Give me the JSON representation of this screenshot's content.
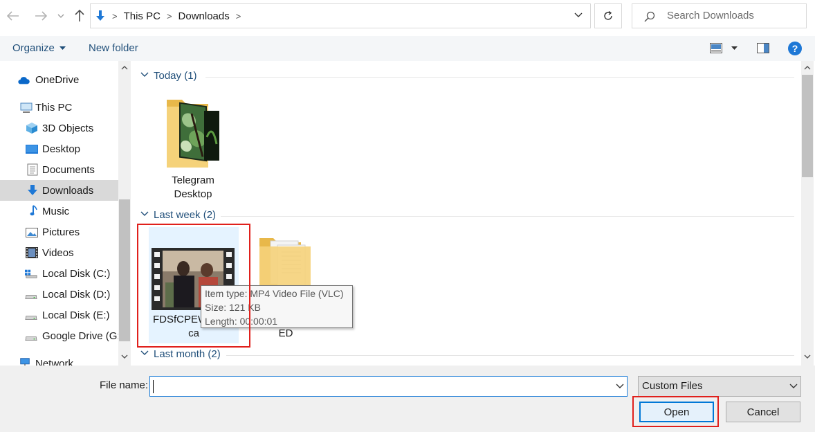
{
  "address_bar": {
    "crumbs": [
      "This PC",
      "Downloads"
    ],
    "search_placeholder": "Search Downloads"
  },
  "toolbar": {
    "organize_label": "Organize",
    "new_folder_label": "New folder",
    "help_label": "?"
  },
  "nav_pane": {
    "items": [
      {
        "label": "OneDrive",
        "icon": "cloud-icon"
      },
      {
        "label": "This PC",
        "icon": "computer-icon"
      },
      {
        "label": "3D Objects",
        "icon": "cube-icon"
      },
      {
        "label": "Desktop",
        "icon": "desktop-icon"
      },
      {
        "label": "Documents",
        "icon": "document-icon"
      },
      {
        "label": "Downloads",
        "icon": "download-arrow-icon",
        "selected": true
      },
      {
        "label": "Music",
        "icon": "music-note-icon"
      },
      {
        "label": "Pictures",
        "icon": "pictures-icon"
      },
      {
        "label": "Videos",
        "icon": "film-icon"
      },
      {
        "label": "Local Disk (C:)",
        "icon": "windows-drive-icon"
      },
      {
        "label": "Local Disk (D:)",
        "icon": "drive-icon"
      },
      {
        "label": "Local Disk (E:)",
        "icon": "drive-icon"
      },
      {
        "label": "Google Drive (G:",
        "icon": "drive-icon"
      },
      {
        "label": "Network",
        "icon": "network-icon"
      }
    ]
  },
  "content": {
    "groups": [
      {
        "title": "Today (1)"
      },
      {
        "title": "Last week (2)"
      },
      {
        "title": "Last month (2)"
      }
    ],
    "files": {
      "telegram": {
        "line1": "Telegram",
        "line2": "Desktop"
      },
      "video": {
        "line1": "FDSfCPEW",
        "line2": "ca"
      },
      "folder2": {
        "line1": "ED"
      }
    },
    "tooltip": {
      "type_line": "Item type: MP4 Video File (VLC)",
      "size_line": "Size: 121 KB",
      "length_line": "Length: 00:00:01"
    }
  },
  "bottom": {
    "file_name_label": "File name:",
    "file_name_value": "",
    "filter_value": "Custom Files",
    "open_label": "Open",
    "cancel_label": "Cancel"
  },
  "colors": {
    "accent_link": "#1f4e79",
    "selection_bg": "#d9d9d9",
    "highlight_red": "#e0201c",
    "focus_blue": "#0078d7"
  }
}
